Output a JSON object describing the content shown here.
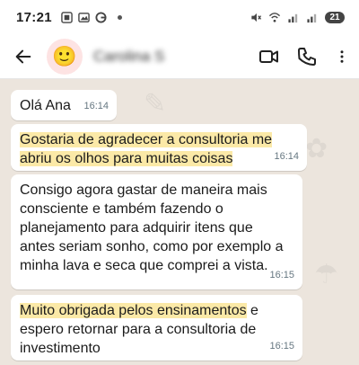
{
  "status_bar": {
    "time": "17:21",
    "battery": "21"
  },
  "header": {
    "contact_name": "Carolina S",
    "avatar_emoji": "🙂",
    "icons": [
      "back-arrow-icon",
      "video-call-icon",
      "phone-call-icon",
      "more-vertical-icon"
    ]
  },
  "messages": [
    {
      "text_before": "Olá Ana",
      "highlight": "",
      "text_after": "",
      "time": "16:14"
    },
    {
      "text_before": "",
      "highlight": "Gostaria de agradecer a consultoria me abriu os olhos para muitas coisas",
      "text_after": "",
      "time": "16:14"
    },
    {
      "text_before": "Consigo agora gastar de maneira mais consciente e também fazendo o planejamento para adquirir itens que antes seriam sonho, como por exemplo a minha lava e seca que comprei a vista.",
      "highlight": "",
      "text_after": "",
      "time": "16:15"
    },
    {
      "text_before": "",
      "highlight": "Muito obrigada pelos ensinamentos",
      "text_after": " e espero retornar para a consultoria de investimento",
      "time": "16:15"
    }
  ],
  "colors": {
    "chat_background": "#ece5dd",
    "bubble": "#ffffff",
    "highlight": "#fbe9a7",
    "timestamp": "#667781"
  }
}
